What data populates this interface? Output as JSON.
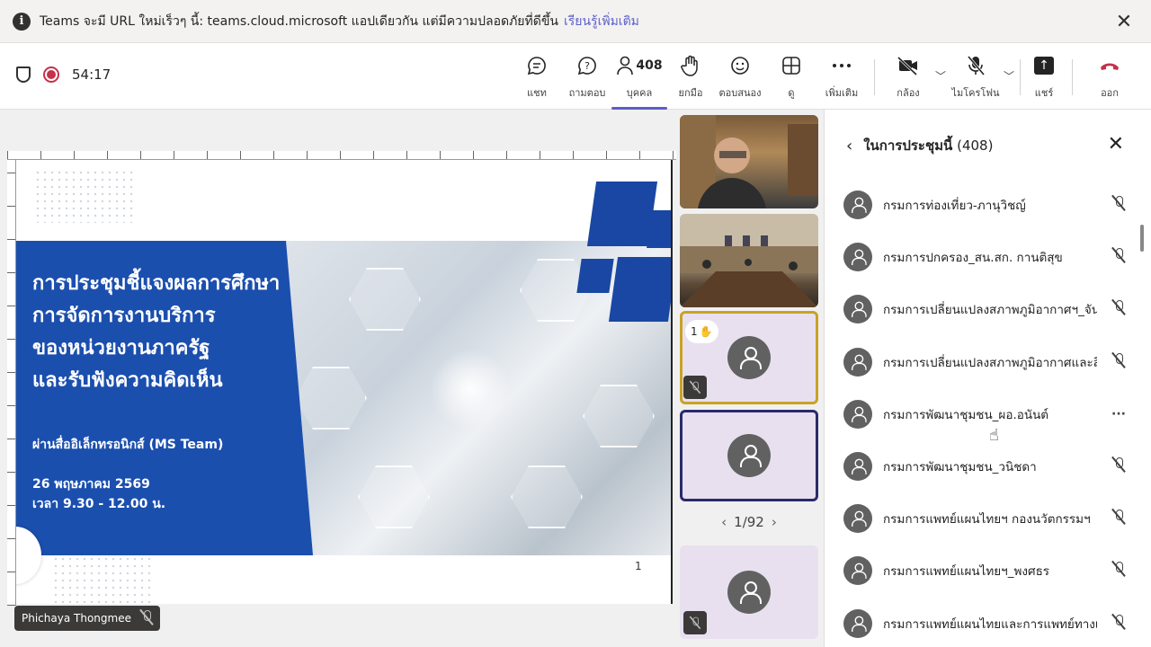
{
  "banner": {
    "message": "Teams จะมี URL ใหม่เร็วๆ นี้: teams.cloud.microsoft แอปเดียวกัน แต่มีความปลอดภัยที่ดีขึ้น",
    "link": "เรียนรู้เพิ่มเติม",
    "info_glyph": "i",
    "close_glyph": "✕"
  },
  "toolbar": {
    "timer": "54:17",
    "chat": "แชท",
    "qa": "ถามตอบ",
    "people": "บุคคล",
    "people_count": "408",
    "raise": "ยกมือ",
    "react": "ตอบสนอง",
    "view": "ดู",
    "more": "เพิ่มเติม",
    "camera": "กล้อง",
    "mic": "ไมโครโฟน",
    "share": "แชร์",
    "leave": "ออก"
  },
  "slide": {
    "title_lines": [
      "การประชุมชี้แจงผลการศึกษา",
      "การจัดการงานบริการ",
      "ของหน่วยงานภาครัฐ",
      "และรับฟังความคิดเห็น"
    ],
    "subtitle": "ผ่านสื่ออิเล็กทรอนิกส์ (MS Team)",
    "date": "26 พฤษภาคม 2569",
    "time": "เวลา 9.30 - 12.00 น.",
    "page_number": "1"
  },
  "presenter": {
    "name": "Phichaya Thongmee"
  },
  "tiles": {
    "hand_count": "1",
    "pager": "1/92"
  },
  "panel": {
    "title": "ในการประชุมนี้",
    "count": "(408)",
    "participants": [
      {
        "name": "กรมการท่องเที่ยว-ภานุวิชญ์",
        "status": "mic-off"
      },
      {
        "name": "กรมการปกครอง_สน.สก. กานติสุข",
        "status": "mic-off"
      },
      {
        "name": "กรมการเปลี่ยนแปลงสภาพภูมิอากาศฯ_จัน...",
        "status": "mic-off"
      },
      {
        "name": "กรมการเปลี่ยนแปลงสภาพภูมิอากาศและสิ่...",
        "status": "mic-off"
      },
      {
        "name": "กรมการพัฒนาชุมชน_ผอ.อนันต์",
        "status": "more"
      },
      {
        "name": "กรมการพัฒนาชุมชน_วนิชดา",
        "status": "mic-off"
      },
      {
        "name": "กรมการแพทย์แผนไทยฯ กองนวัตกรรมฯ",
        "status": "mic-off"
      },
      {
        "name": "กรมการแพทย์แผนไทยฯ_พงศธร",
        "status": "mic-off"
      },
      {
        "name": "กรมการแพทย์แผนไทยและการแพทย์ทางเลื...",
        "status": "mic-off"
      }
    ]
  }
}
